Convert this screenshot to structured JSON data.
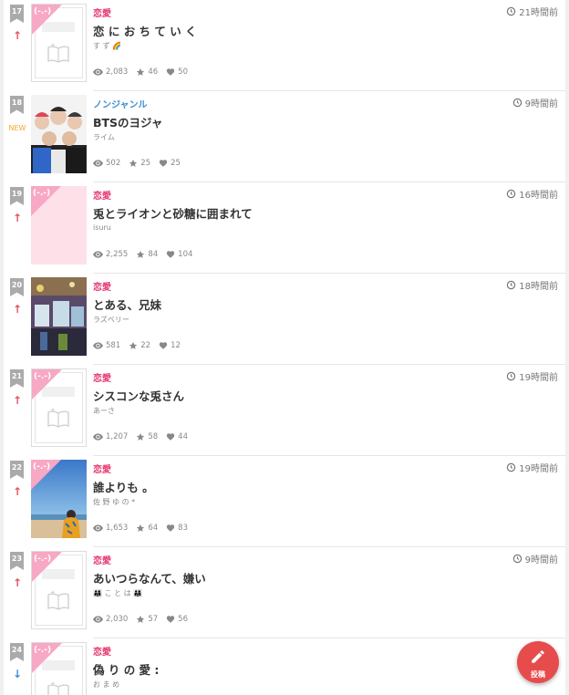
{
  "rankings": [
    {
      "rank": "17",
      "indicator": "up",
      "genre": "恋愛",
      "genre_color": "#e5386f",
      "time": "21時間前",
      "title": "恋 に お ち て い く",
      "author": "す ず 🌈",
      "views": "2,083",
      "stars": "46",
      "likes": "50",
      "cover": "default"
    },
    {
      "rank": "18",
      "indicator": "new",
      "new_label": "NEW",
      "genre": "ノンジャンル",
      "genre_color": "#3d8fd6",
      "time": "9時間前",
      "title": "BTSのヨジャ",
      "author": "ライム",
      "views": "502",
      "stars": "25",
      "likes": "25",
      "cover": "photo-group"
    },
    {
      "rank": "19",
      "indicator": "up",
      "genre": "恋愛",
      "genre_color": "#e5386f",
      "time": "16時間前",
      "title": "兎とライオンと砂糖に囲まれて",
      "author": "isuru",
      "views": "2,255",
      "stars": "84",
      "likes": "104",
      "cover": "pink"
    },
    {
      "rank": "20",
      "indicator": "up",
      "genre": "恋愛",
      "genre_color": "#e5386f",
      "time": "18時間前",
      "title": "とある、兄妹",
      "author": "ラズベリー",
      "views": "581",
      "stars": "22",
      "likes": "12",
      "cover": "photo-concert"
    },
    {
      "rank": "21",
      "indicator": "up",
      "genre": "恋愛",
      "genre_color": "#e5386f",
      "time": "19時間前",
      "title": "シスコンな兎さん",
      "author": "あーさ",
      "views": "1,207",
      "stars": "58",
      "likes": "44",
      "cover": "default"
    },
    {
      "rank": "22",
      "indicator": "up",
      "genre": "恋愛",
      "genre_color": "#e5386f",
      "time": "19時間前",
      "title": "誰よりも 。",
      "author": "佐 野 ゆ の *",
      "views": "1,653",
      "stars": "64",
      "likes": "83",
      "cover": "photo-beach"
    },
    {
      "rank": "23",
      "indicator": "up",
      "genre": "恋愛",
      "genre_color": "#e5386f",
      "time": "9時間前",
      "title": "あいつらなんて、嫌い",
      "author": "👨‍👩‍👧 こ と は 👨‍👩‍👧",
      "views": "2,030",
      "stars": "57",
      "likes": "56",
      "cover": "default"
    },
    {
      "rank": "24",
      "indicator": "down",
      "genre": "恋愛",
      "genre_color": "#e5386f",
      "time": "",
      "title": "偽 り の 愛 :",
      "author": "お ま め",
      "views": "",
      "stars": "",
      "likes": "",
      "cover": "default"
    }
  ],
  "corner_label": "(-.-)",
  "fab": {
    "label": "投稿",
    "icon": "pencil-icon",
    "color": "#e74c4c"
  },
  "colors": {
    "rank_badge": "#aaaaaa",
    "up_arrow": "#e25563",
    "down_arrow": "#3d8fd6",
    "new": "#f5a623"
  }
}
